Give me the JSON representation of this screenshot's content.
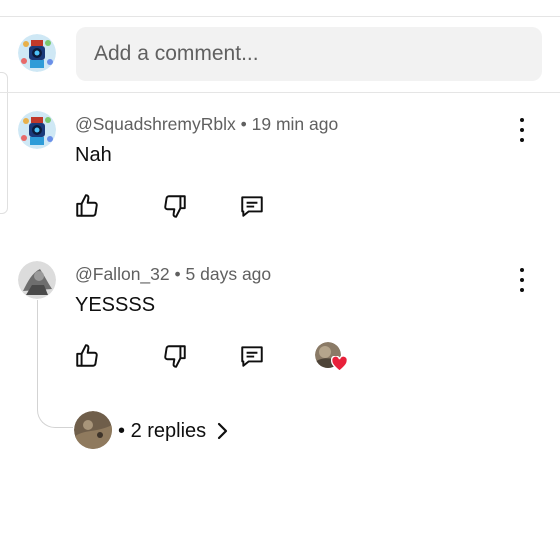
{
  "composer": {
    "placeholder": "Add a comment..."
  },
  "comments": [
    {
      "author": "@SquadshremyRblx",
      "time": "19 min ago",
      "text": "Nah",
      "actions": [
        "like-icon",
        "dislike-icon",
        "reply-icon"
      ]
    },
    {
      "author": "@Fallon_32",
      "time": "5 days ago",
      "text": "YESSSS",
      "actions": [
        "like-icon",
        "dislike-icon",
        "reply-icon"
      ],
      "creator_hearted": true,
      "replies_label": "2 replies"
    }
  ],
  "colors": {
    "text": "#0f0f0f",
    "meta": "#606060",
    "input_bg": "#f2f2f2",
    "heart": "#e8213a"
  }
}
